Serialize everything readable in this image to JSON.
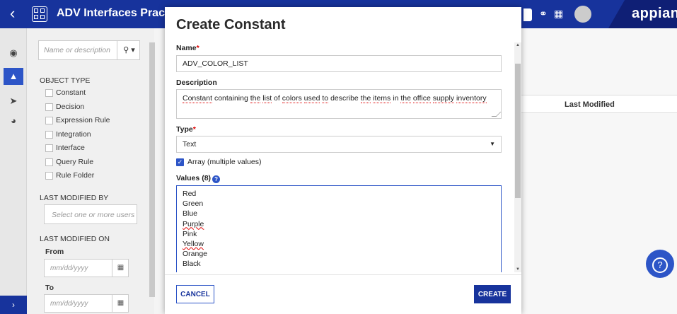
{
  "topbar": {
    "app_title": "ADV Interfaces Practice",
    "brand": "appian"
  },
  "filters": {
    "search_placeholder": "Name or description",
    "object_type_heading": "OBJECT TYPE",
    "object_types": [
      "Constant",
      "Decision",
      "Expression Rule",
      "Integration",
      "Interface",
      "Query Rule",
      "Rule Folder"
    ],
    "last_modified_by_heading": "LAST MODIFIED BY",
    "users_placeholder": "Select one or more users",
    "last_modified_on_heading": "LAST MODIFIED ON",
    "from_label": "From",
    "to_label": "To",
    "date_placeholder": "mm/dd/yyyy"
  },
  "grid": {
    "last_modified_header": "Last Modified"
  },
  "modal": {
    "title": "Create Constant",
    "name_label": "Name",
    "name_value": "ADV_COLOR_LIST",
    "description_label": "Description",
    "description_value": "Constant containing the list of colors used to describe the items in the office supply inventory",
    "type_label": "Type",
    "type_value": "Text",
    "array_label": "Array (multiple values)",
    "values_label": "Values (8)",
    "values": [
      "Red",
      "Green",
      "Blue",
      "Purple",
      "Pink",
      "Yellow",
      "Orange",
      "Black"
    ],
    "cancel_label": "CANCEL",
    "create_label": "CREATE"
  },
  "colors": {
    "header_blue": "#17339c",
    "accent_blue": "#2d55c7"
  }
}
